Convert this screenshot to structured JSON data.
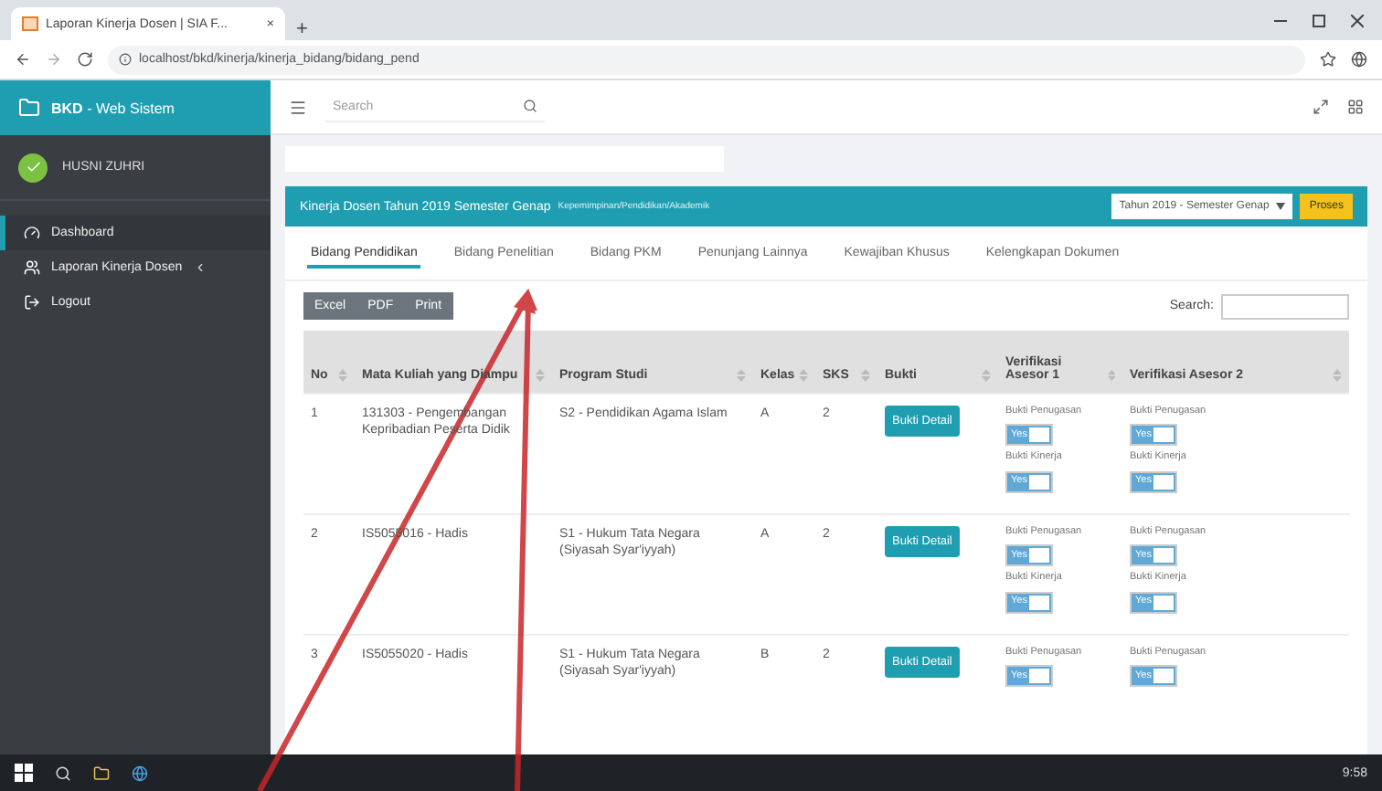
{
  "browser": {
    "tab_title": "Laporan Kinerja Dosen | SIA F...",
    "tab_close": "×",
    "new_tab": "+",
    "url": "localhost/bkd/kinerja/kinerja_bidang/bidang_pend"
  },
  "sidebar": {
    "brand": "BKD",
    "brand_suffix": " - Web Sistem",
    "user": "HUSNI ZUHRI",
    "menu": [
      {
        "label": "Dashboard",
        "kind": "dashboard",
        "selected": true,
        "has_submenu": false
      },
      {
        "label": "Laporan Kinerja Dosen",
        "kind": "users",
        "selected": false,
        "has_submenu": true
      },
      {
        "label": "Logout",
        "kind": "logout",
        "selected": false,
        "has_submenu": false
      }
    ]
  },
  "topbar": {
    "search_placeholder": "Search"
  },
  "panel": {
    "title": "Kinerja Dosen Tahun 2019 Semester Genap",
    "subtitle": "Kepemimpinan/Pendidikan/Akademik",
    "period_select": "Tahun 2019 - Semester Genap",
    "process_button": "Proses"
  },
  "tabs": [
    {
      "label": "Bidang Pendidikan",
      "selected": true
    },
    {
      "label": "Bidang Penelitian",
      "selected": false
    },
    {
      "label": "Bidang PKM",
      "selected": false
    },
    {
      "label": "Penunjang Lainnya",
      "selected": false
    },
    {
      "label": "Kewajiban Khusus",
      "selected": false
    },
    {
      "label": "Kelengkapan Dokumen",
      "selected": false
    }
  ],
  "export_buttons": [
    "Excel",
    "PDF",
    "Print"
  ],
  "search_label": "Search:",
  "table": {
    "columns": [
      "No",
      "Mata Kuliah yang Diampu",
      "Program Studi",
      "Kelas",
      "SKS",
      "Bukti",
      "Verifikasi Asesor 1",
      "Verifikasi Asesor 2"
    ],
    "rows": [
      {
        "no": "1",
        "course": "131303 - Pengembangan Kepribadian Peserta Didik",
        "program": "S2 - Pendidikan Agama Islam",
        "class": "A",
        "sks": "2",
        "proof_button": "Bukti Detail",
        "assessor_1": [
          {
            "label": "Bukti Penugasan",
            "toggle": "Yes",
            "on": true
          },
          {
            "label": "Bukti Kinerja",
            "toggle": "Yes",
            "on": true
          }
        ],
        "assessor_2": [
          {
            "label": "Bukti Penugasan",
            "toggle": "Yes",
            "on": true
          },
          {
            "label": "Bukti Kinerja",
            "toggle": "Yes",
            "on": true
          }
        ]
      },
      {
        "no": "2",
        "course": "IS5055016 - Hadis",
        "program": "S1 - Hukum Tata Negara (Siyasah Syar'iyyah)",
        "class": "A",
        "sks": "2",
        "proof_button": "Bukti Detail",
        "assessor_1": [
          {
            "label": "Bukti Penugasan",
            "toggle": "Yes",
            "on": true
          },
          {
            "label": "Bukti Kinerja",
            "toggle": "Yes",
            "on": true
          }
        ],
        "assessor_2": [
          {
            "label": "Bukti Penugasan",
            "toggle": "Yes",
            "on": true
          },
          {
            "label": "Bukti Kinerja",
            "toggle": "Yes",
            "on": true
          }
        ]
      },
      {
        "no": "3",
        "course": "IS5055020 - Hadis",
        "program": "S1 - Hukum Tata Negara (Siyasah Syar'iyyah)",
        "class": "B",
        "sks": "2",
        "proof_button": "Bukti Detail",
        "assessor_1": [
          {
            "label": "Bukti Penugasan",
            "toggle": "Yes",
            "on": true
          }
        ],
        "assessor_2": [
          {
            "label": "Bukti Penugasan",
            "toggle": "Yes",
            "on": true
          }
        ]
      }
    ]
  },
  "taskbar": {
    "clock": "9:58"
  }
}
